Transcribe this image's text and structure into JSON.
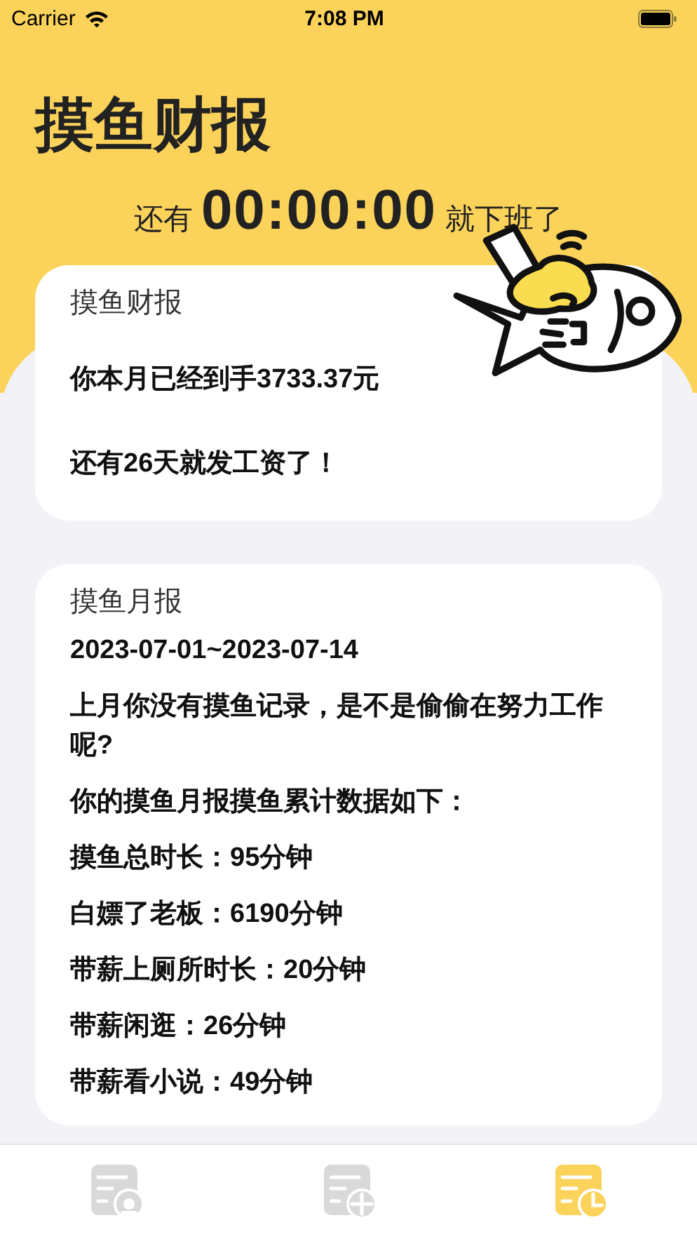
{
  "status_bar": {
    "carrier": "Carrier",
    "time": "7:08 PM"
  },
  "header": {
    "title": "摸鱼财报",
    "countdown_prefix": "还有",
    "countdown": "00:00:00",
    "countdown_suffix": "就下班了"
  },
  "cards": [
    {
      "kind": "summary",
      "title": "摸鱼财报",
      "lines": [
        "你本月已经到手3733.37元",
        "还有26天就发工资了！"
      ]
    },
    {
      "kind": "report",
      "title": "摸鱼月报",
      "lines": [
        "2023-07-01~2023-07-14",
        "上月你没有摸鱼记录，是不是偷偷在努力工作呢?",
        "你的摸鱼月报摸鱼累计数据如下：",
        "摸鱼总时长：95分钟",
        "白嫖了老板：6190分钟",
        "带薪上厕所时长：20分钟",
        "带薪闲逛：26分钟",
        "带薪看小说：49分钟"
      ]
    }
  ],
  "tab_bar": [
    {
      "kind": "person",
      "selected": false
    },
    {
      "kind": "add",
      "selected": false
    },
    {
      "kind": "clock",
      "selected": true
    }
  ]
}
